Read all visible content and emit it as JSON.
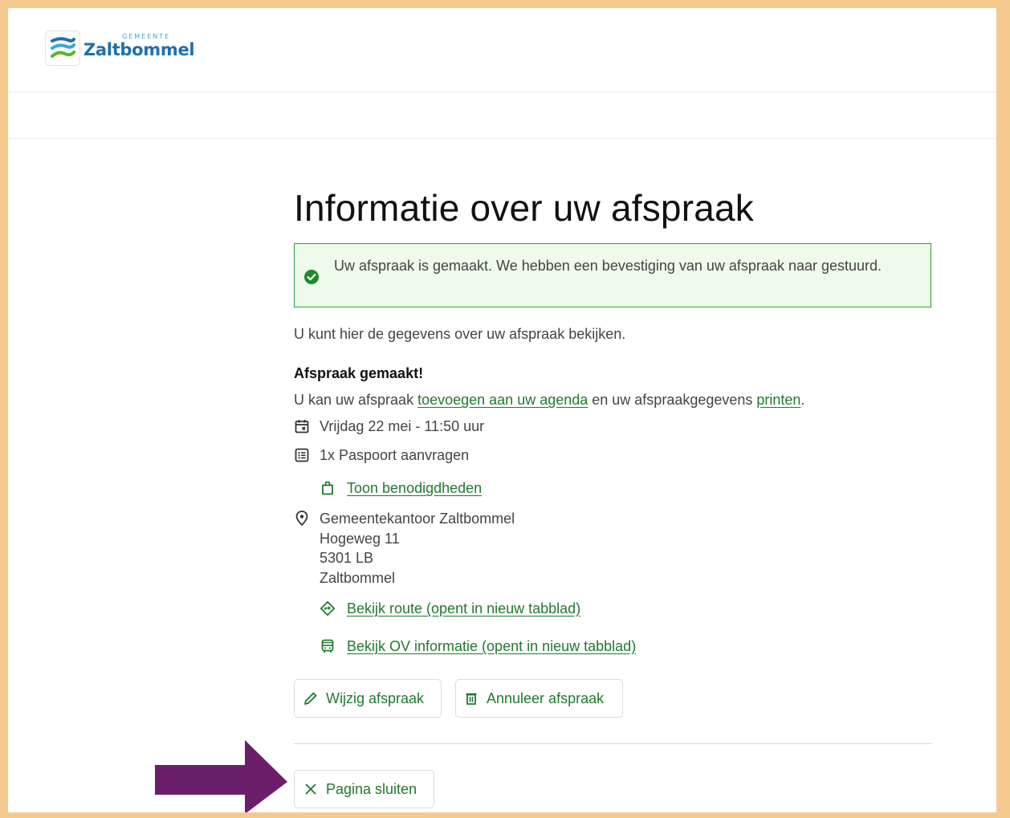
{
  "brand": {
    "prefix": "GEMEENTE",
    "name": "Zaltbommel",
    "colors": {
      "blue": "#1f6fb0",
      "light_blue": "#3ba7d4",
      "green": "#5ab42c"
    }
  },
  "page": {
    "title": "Informatie over uw afspraak"
  },
  "alert": {
    "icon": "check-circle-icon",
    "text": "Uw afspraak is gemaakt. We hebben een bevestiging van uw afspraak naar gestuurd.",
    "color": "#2e9a3a"
  },
  "intro": "U kunt hier de gegevens over uw afspraak bekijken.",
  "appointment": {
    "heading": "Afspraak gemaakt!",
    "sentence_start": "U kan uw afspraak ",
    "agenda_link": "toevoegen aan uw agenda",
    "sentence_middle": " en uw afspraakgegevens ",
    "print_link": "printen",
    "sentence_end": ".",
    "datetime": "Vrijdag 22 mei - 11:50 uur",
    "product": "1x Paspoort aanvragen",
    "requirements_link": "Toon benodigdheden",
    "location": {
      "name": "Gemeentekantoor Zaltbommel",
      "street": "Hogeweg 11",
      "postcode": "5301 LB",
      "city": "Zaltbommel"
    },
    "route_link": "Bekijk route (opent in nieuw tabblad)",
    "ov_link": "Bekijk OV informatie (opent in nieuw tabblad)"
  },
  "actions": {
    "edit": "Wijzig afspraak",
    "cancel": "Annuleer afspraak",
    "close": "Pagina sluiten"
  },
  "annotation": {
    "arrow_color": "#6b1f6b"
  },
  "accent_color": "#1f7a2c"
}
